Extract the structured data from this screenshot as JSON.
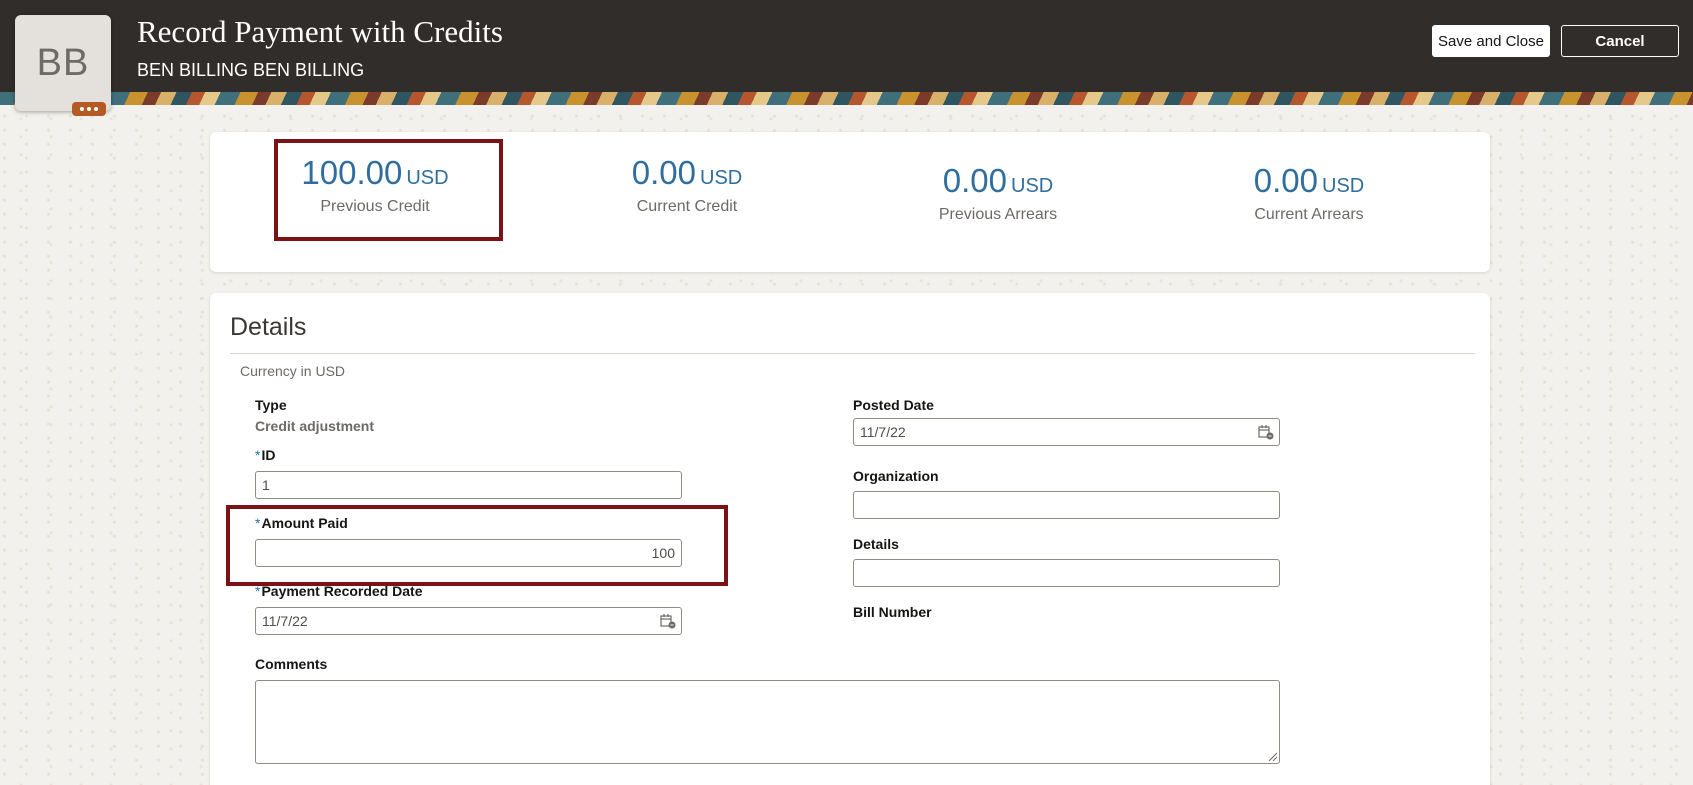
{
  "header": {
    "avatar_initials": "BB",
    "title": "Record Payment with Credits",
    "subtitle": "BEN BILLING BEN BILLING",
    "save_label": "Save and Close",
    "cancel_label": "Cancel"
  },
  "summary": {
    "metrics": [
      {
        "value": "100.00",
        "unit": "USD",
        "label": "Previous Credit"
      },
      {
        "value": "0.00",
        "unit": "USD",
        "label": "Current Credit"
      },
      {
        "value": "0.00",
        "unit": "USD",
        "label": "Previous Arrears"
      },
      {
        "value": "0.00",
        "unit": "USD",
        "label": "Current Arrears"
      }
    ]
  },
  "details": {
    "title": "Details",
    "currency_note": "Currency in USD",
    "required_marker": "*",
    "type_label": "Type",
    "type_value": "Credit adjustment",
    "id_label": "ID",
    "id_value": "1",
    "amount_label": "Amount Paid",
    "amount_value": "100",
    "recorded_date_label": "Payment Recorded Date",
    "recorded_date_value": "11/7/22",
    "posted_date_label": "Posted Date",
    "posted_date_value": "11/7/22",
    "organization_label": "Organization",
    "organization_value": "",
    "details_label": "Details",
    "details_value": "",
    "bill_number_label": "Bill Number",
    "comments_label": "Comments"
  },
  "colors": {
    "header_bg": "#312d2a",
    "accent_blue": "#2f6e9e",
    "highlight": "#7b1216"
  }
}
